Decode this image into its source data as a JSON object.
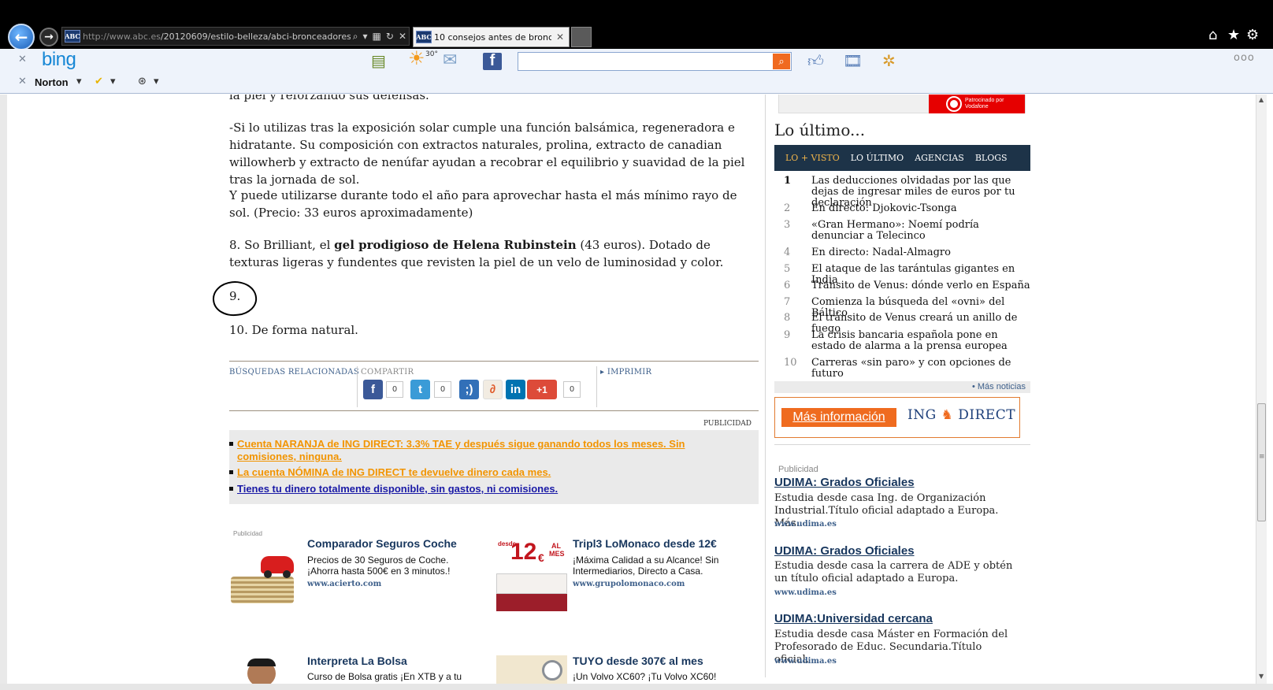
{
  "browser": {
    "address_prefix": "http://www.abc.es",
    "address_rest": "/20120609/estilo-belleza/abci-bronceadores",
    "tab_favicon": "ABC",
    "tab_title": "10 consejos antes de bronc...",
    "back_icon": "back-arrow-icon",
    "forward_icon": "forward-arrow-icon"
  },
  "toolbar": {
    "bing_logo": "bing",
    "weather_temp": "30°",
    "search_placeholder": "",
    "norton_label": "Norton",
    "more_icon": "ooo"
  },
  "article": {
    "p1": "la piel y reforzando sus defensas.",
    "p2": "-Si lo utilizas tras la exposición solar cumple una función balsámica, regeneradora e hidratante. Su composición con extractos naturales, prolina, extracto de canadian willowherb y extracto de nenúfar ayudan a recobrar el equilibrio y suavidad de la piel tras la jornada de sol.",
    "p3": "Y puede utilizarse durante todo el año para aprovechar hasta el más mínimo rayo de sol. (Precio: 33 euros aproximadamente)",
    "p4_a": "8. So Brilliant, el ",
    "p4_b": "gel prodigioso de Helena Rubinstein",
    "p4_c": " (43 euros). Dotado de texturas ligeras y fundentes que revisten la piel de un velo de luminosidad y color.",
    "item9": "9.",
    "item10": "10. De forma natural."
  },
  "share": {
    "busquedas": "BÚSQUEDAS RELACIONADAS",
    "compartir": "COMPARTIR",
    "imprimir": "IMPRIMIR",
    "counts": [
      "0",
      "0",
      "0"
    ],
    "gplus": "+1"
  },
  "ads": {
    "publicidad": "PUBLICIDAD",
    "lines": [
      "Cuenta NARANJA de ING DIRECT: 3.3% TAE y después sigue ganando todos los meses. Sin comisiones, ninguna.",
      "La cuenta NÓMINA de ING DIRECT te devuelve dinero cada mes.",
      "Tienes tu dinero totalmente disponible, sin gastos, ni comisiones."
    ],
    "colors": {
      "orange": "#f29400",
      "blue": "#1a1aa6"
    }
  },
  "promos": {
    "publicidad": "Publicidad",
    "items": [
      {
        "title": "Comparador Seguros Coche",
        "desc1": "Precios de 30 Seguros de Coche.",
        "desc2": "¡Ahorra hasta 500€ en 3 minutos.!",
        "url": "www.acierto.com"
      },
      {
        "title": "Tripl3 LoMonaco desde 12€",
        "desc1": "¡Máxima Calidad a su Alcance! Sin",
        "desc2": "Intermediarios, Directo a Casa.",
        "url": "www.grupolomonaco.com",
        "img_desde": "desde",
        "img_price": "12",
        "img_cur": "€",
        "img_al": "AL",
        "img_mes": "MES"
      },
      {
        "title": "Interpreta La Bolsa",
        "desc1": "Curso de Bolsa gratis ¡En XTB y a tu",
        "desc2": "",
        "url": ""
      },
      {
        "title": "TUYO desde 307€ al mes",
        "desc1": "¡Un Volvo XC60? ¡Tu Volvo XC60!",
        "desc2": "",
        "url": ""
      }
    ]
  },
  "sidebar": {
    "vodafone": "Patrocinado por Vodafone",
    "ultimo_title": "Lo último...",
    "tabs": [
      "LO + VISTO",
      "LO ÚLTIMO",
      "AGENCIAS",
      "BLOGS"
    ],
    "news": [
      {
        "n": "1",
        "t": "Las deducciones olvidadas por las que dejas de ingresar miles de euros por tu declaración"
      },
      {
        "n": "2",
        "t": "En directo: Djokovic-Tsonga"
      },
      {
        "n": "3",
        "t": "«Gran Hermano»: Noemí podría denunciar a Telecinco"
      },
      {
        "n": "4",
        "t": "En directo: Nadal-Almagro"
      },
      {
        "n": "5",
        "t": "El ataque de las tarántulas gigantes en India"
      },
      {
        "n": "6",
        "t": "Tránsito de Venus: dónde verlo en España"
      },
      {
        "n": "7",
        "t": "Comienza la búsqueda del «ovni» del Báltico"
      },
      {
        "n": "8",
        "t": "El tránsito de Venus creará un anillo de fuego"
      },
      {
        "n": "9",
        "t": "La crisis bancaria española pone en estado de alarma a la prensa europea"
      },
      {
        "n": "10",
        "t": "Carreras «sin paro» y con opciones de futuro"
      }
    ],
    "mas_noticias": "• Más noticias",
    "ing_btn": "Más información",
    "ing_logo_a": "ING",
    "ing_logo_b": "DIRECT",
    "udima_pub": "Publicidad",
    "udima": [
      {
        "title": "UDIMA: Grados Oficiales",
        "desc": "Estudia desde casa Ing. de Organización Industrial.Título oficial adaptado a Europa. Más..",
        "url": "www.udima.es"
      },
      {
        "title": "UDIMA: Grados Oficiales",
        "desc": "Estudia desde casa la carrera de ADE y obtén un título oficial adaptado a Europa.",
        "url": "www.udima.es"
      },
      {
        "title": "UDIMA:Universidad cercana",
        "desc": "Estudia desde casa Máster en Formación del Profesorado de Educ. Secundaria.Título oficial.",
        "url": "www.udima.es"
      }
    ]
  }
}
